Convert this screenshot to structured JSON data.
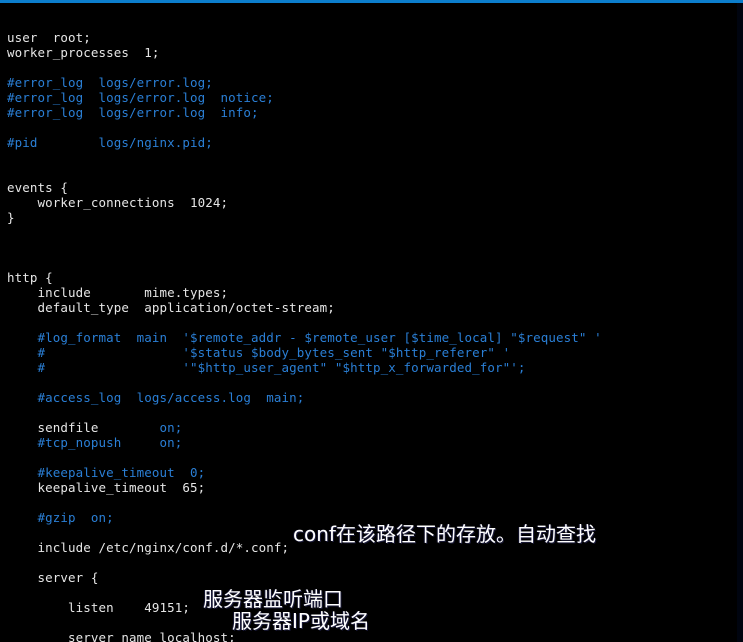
{
  "window": {
    "background_color": "#000000",
    "accent_bar_color": "#0c7ecd",
    "right_edge_color": "#00040f"
  },
  "theme": {
    "code_color": "#e6e6e6",
    "comment_color": "#2a7fd6",
    "annotation_color": "#ffffff"
  },
  "editor": {
    "file_type": "nginx-config",
    "lines": [
      {
        "kind": "plain",
        "text": "user  root;"
      },
      {
        "kind": "plain",
        "text": "worker_processes  1;"
      },
      {
        "kind": "blank",
        "text": " "
      },
      {
        "kind": "comment",
        "text": "#error_log  logs/error.log;"
      },
      {
        "kind": "comment",
        "text": "#error_log  logs/error.log  notice;"
      },
      {
        "kind": "comment",
        "text": "#error_log  logs/error.log  info;"
      },
      {
        "kind": "blank",
        "text": " "
      },
      {
        "kind": "comment",
        "text": "#pid        logs/nginx.pid;"
      },
      {
        "kind": "blank",
        "text": " "
      },
      {
        "kind": "blank",
        "text": " "
      },
      {
        "kind": "plain",
        "text": "events {"
      },
      {
        "kind": "plain",
        "text": "    worker_connections  1024;"
      },
      {
        "kind": "plain",
        "text": "}"
      },
      {
        "kind": "blank",
        "text": " "
      },
      {
        "kind": "blank",
        "text": " "
      },
      {
        "kind": "blank",
        "text": " "
      },
      {
        "kind": "plain",
        "text": "http {"
      },
      {
        "kind": "plain",
        "text": "    include       mime.types;"
      },
      {
        "kind": "plain",
        "text": "    default_type  application/octet-stream;"
      },
      {
        "kind": "blank",
        "text": " "
      },
      {
        "kind": "comment",
        "text": "    #log_format  main  '$remote_addr - $remote_user [$time_local] \"$request\" '"
      },
      {
        "kind": "comment",
        "text": "    #                  '$status $body_bytes_sent \"$http_referer\" '"
      },
      {
        "kind": "comment",
        "text": "    #                  '\"$http_user_agent\" \"$http_x_forwarded_for\"';"
      },
      {
        "kind": "blank",
        "text": " "
      },
      {
        "kind": "comment",
        "text": "    #access_log  logs/access.log  main;"
      },
      {
        "kind": "blank",
        "text": " "
      },
      {
        "kind": "mixed",
        "code": "    sendfile        ",
        "comment": "on;"
      },
      {
        "kind": "comment",
        "text": "    #tcp_nopush     on;"
      },
      {
        "kind": "blank",
        "text": " "
      },
      {
        "kind": "comment",
        "text": "    #keepalive_timeout  0;"
      },
      {
        "kind": "plain",
        "text": "    keepalive_timeout  65;"
      },
      {
        "kind": "blank",
        "text": " "
      },
      {
        "kind": "comment",
        "text": "    #gzip  on;"
      },
      {
        "kind": "blank",
        "text": " "
      },
      {
        "kind": "plain",
        "text": "    include /etc/nginx/conf.d/*.conf;"
      },
      {
        "kind": "blank",
        "text": " "
      },
      {
        "kind": "plain",
        "text": "    server {"
      },
      {
        "kind": "blank",
        "text": " "
      },
      {
        "kind": "plain",
        "text": "        listen    49151;"
      },
      {
        "kind": "blank",
        "text": " "
      },
      {
        "kind": "plain",
        "text": "        server_name localhost;"
      }
    ]
  },
  "annotations": {
    "conf_path": "conf在该路径下的存放。自动查找",
    "listen_port": "服务器监听端口",
    "server_name": "服务器IP或域名"
  }
}
